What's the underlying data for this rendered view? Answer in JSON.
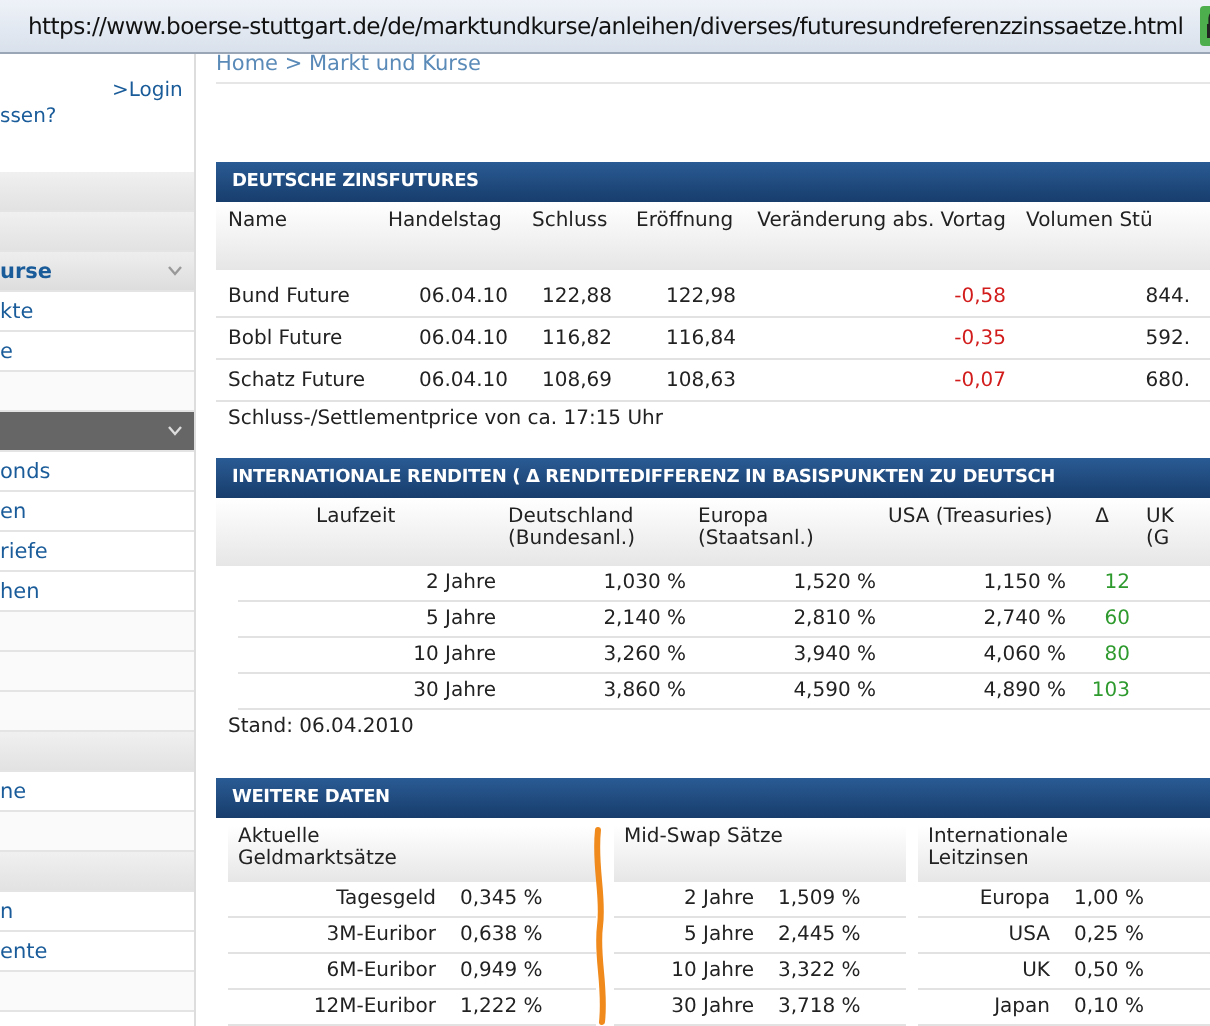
{
  "address_bar": {
    "url": "https://www.boerse-stuttgart.de/de/marktundkurse/anleihen/diverses/futuresundreferenzzinssaetze.html"
  },
  "sidebar": {
    "login_link": ">Login",
    "forgot_text": "ssen?",
    "items": [
      {
        "kind": "group"
      },
      {
        "kind": "group"
      },
      {
        "kind": "heading",
        "label": "urse",
        "expanded": true
      },
      {
        "kind": "link",
        "label": "kte"
      },
      {
        "kind": "link",
        "label": "e"
      },
      {
        "kind": "blank"
      },
      {
        "kind": "section",
        "expanded": true
      },
      {
        "kind": "link",
        "label": "onds"
      },
      {
        "kind": "link",
        "label": "en"
      },
      {
        "kind": "link",
        "label": "riefe"
      },
      {
        "kind": "link",
        "label": "hen"
      },
      {
        "kind": "blank"
      },
      {
        "kind": "blank"
      },
      {
        "kind": "blank"
      },
      {
        "kind": "group"
      },
      {
        "kind": "link",
        "label": "ne"
      },
      {
        "kind": "blank"
      },
      {
        "kind": "group"
      },
      {
        "kind": "link",
        "label": "n"
      },
      {
        "kind": "link",
        "label": "ente"
      },
      {
        "kind": "blank"
      }
    ]
  },
  "breadcrumb": "Home > Markt und Kurse",
  "futures": {
    "title": "DEUTSCHE ZINSFUTURES",
    "columns": [
      "Name",
      "Handelstag",
      "Schluss",
      "Eröffnung",
      "Veränderung abs. Vortag",
      "Volumen Stü"
    ],
    "rows": [
      {
        "name": "Bund Future",
        "date": "06.04.10",
        "close": "122,88",
        "open": "122,98",
        "change": "-0,58",
        "volume": "844."
      },
      {
        "name": "Bobl Future",
        "date": "06.04.10",
        "close": "116,82",
        "open": "116,84",
        "change": "-0,35",
        "volume": "592."
      },
      {
        "name": "Schatz Future",
        "date": "06.04.10",
        "close": "108,69",
        "open": "108,63",
        "change": "-0,07",
        "volume": "680."
      }
    ],
    "note": "Schluss-/Settlementprice von ca. 17:15 Uhr"
  },
  "yields": {
    "title": "INTERNATIONALE RENDITEN ( Δ RENDITEDIFFERENZ IN BASISPUNKTEN ZU DEUTSCH",
    "columns": [
      "Laufzeit",
      "Deutschland (Bundesanl.)",
      "Europa (Staatsanl.)",
      "USA (Treasuries)",
      "Δ",
      "UK (G"
    ],
    "rows": [
      {
        "term": "2 Jahre",
        "de": "1,030 %",
        "eu": "1,520 %",
        "us": "1,150 %",
        "delta": "12"
      },
      {
        "term": "5 Jahre",
        "de": "2,140 %",
        "eu": "2,810 %",
        "us": "2,740 %",
        "delta": "60"
      },
      {
        "term": "10 Jahre",
        "de": "3,260 %",
        "eu": "3,940 %",
        "us": "4,060 %",
        "delta": "80"
      },
      {
        "term": "30 Jahre",
        "de": "3,860 %",
        "eu": "4,590 %",
        "us": "4,890 %",
        "delta": "103"
      }
    ],
    "note": "Stand: 06.04.2010"
  },
  "more": {
    "title": "WEITERE DATEN",
    "blocks": [
      {
        "heading": "Aktuelle Geldmarktsätze",
        "rows": [
          {
            "label": "Tagesgeld",
            "value": "0,345 %"
          },
          {
            "label": "3M-Euribor",
            "value": "0,638 %"
          },
          {
            "label": "6M-Euribor",
            "value": "0,949 %"
          },
          {
            "label": "12M-Euribor",
            "value": "1,222 %"
          }
        ]
      },
      {
        "heading": "Mid-Swap Sätze",
        "rows": [
          {
            "label": "2 Jahre",
            "value": "1,509 %"
          },
          {
            "label": "5 Jahre",
            "value": "2,445 %"
          },
          {
            "label": "10 Jahre",
            "value": "3,322 %"
          },
          {
            "label": "30 Jahre",
            "value": "3,718 %"
          }
        ]
      },
      {
        "heading": "Internationale Leitzinsen",
        "rows": [
          {
            "label": "Europa",
            "value": "1,00 %"
          },
          {
            "label": "USA",
            "value": "0,25 %"
          },
          {
            "label": "UK",
            "value": "0,50 %"
          },
          {
            "label": "Japan",
            "value": "0,10 %"
          }
        ]
      }
    ]
  }
}
